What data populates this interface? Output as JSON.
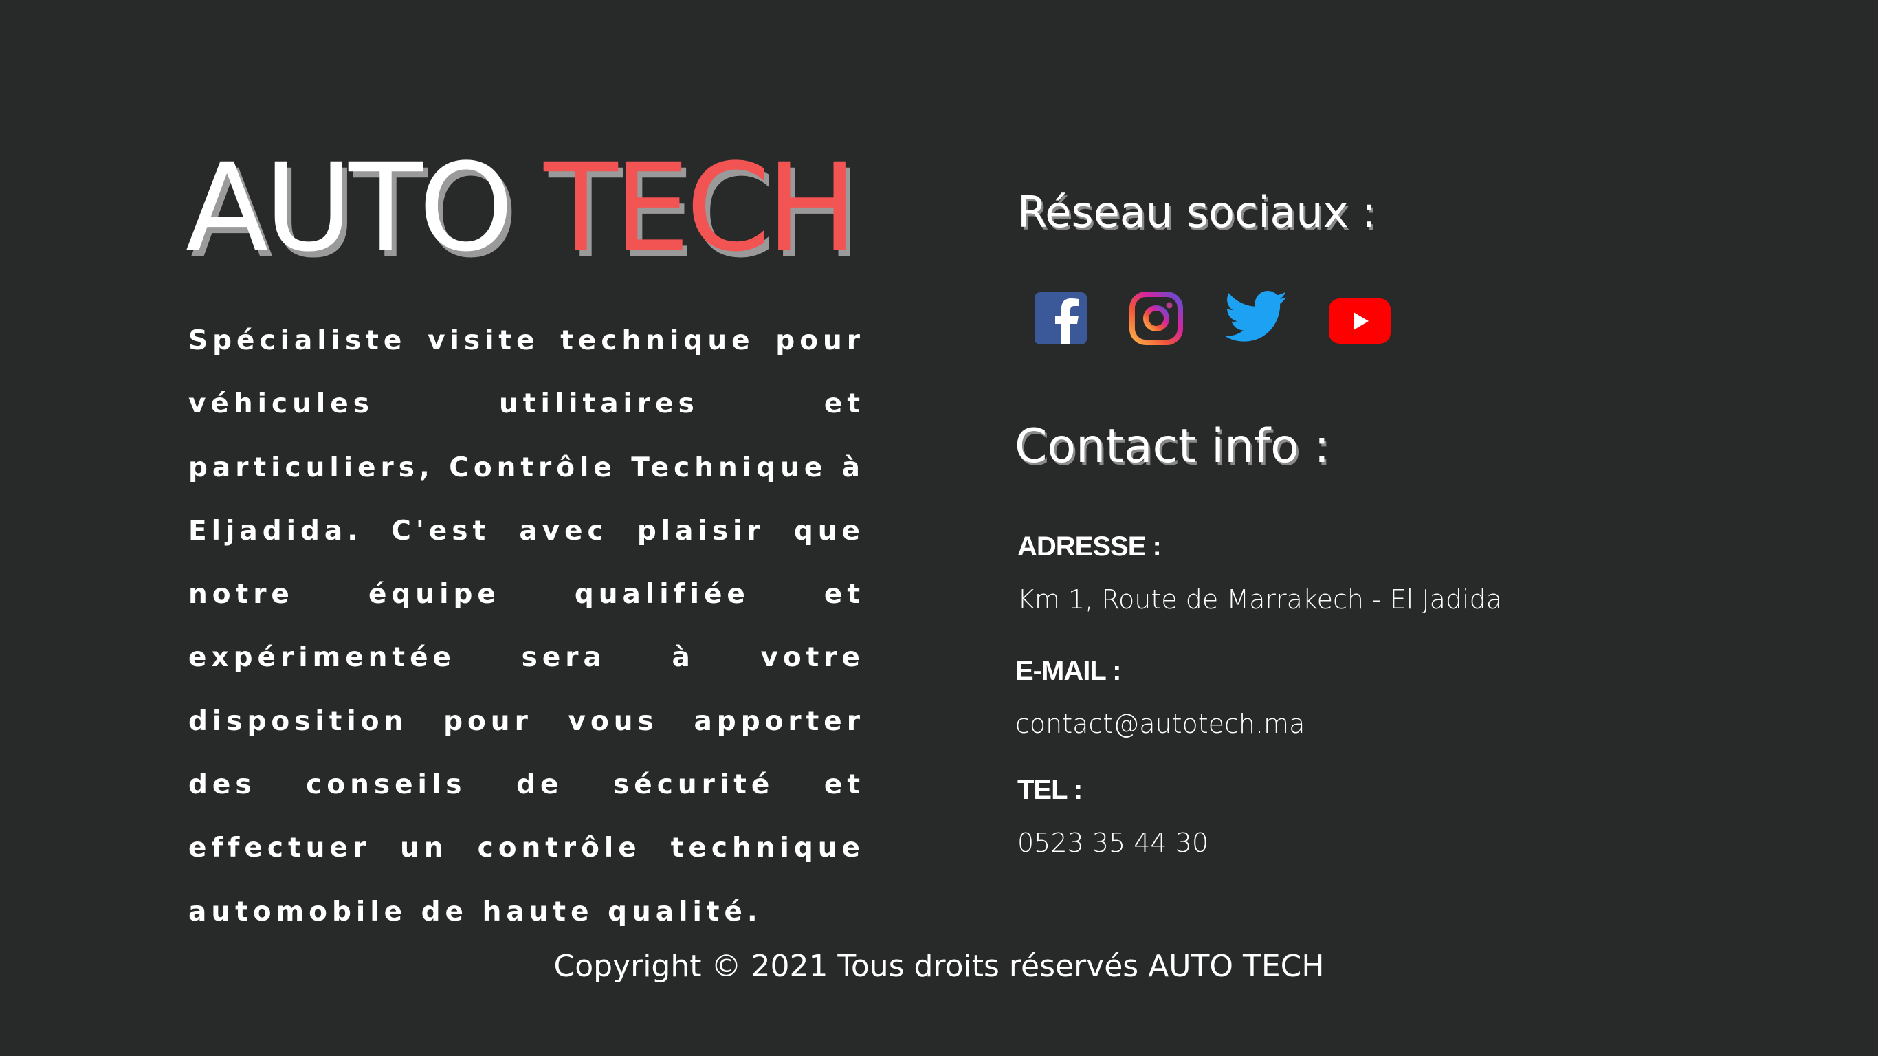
{
  "brand": {
    "part1": "AUTO ",
    "part2": "TECH",
    "accent_color": "#f25453",
    "text_color": "#ffffff",
    "background_color": "#282929"
  },
  "description": "Spécialiste visite technique pour véhicules utilitaires et particuliers, Contrôle Technique à Eljadida. C'est avec plaisir que notre équipe qualifiée et expérimentée sera à votre disposition pour vous apporter des conseils de sécurité et effectuer un contrôle technique automobile de haute qualité.",
  "social": {
    "title": "Réseau sociaux :",
    "icons": [
      {
        "name": "facebook-icon",
        "color": "#3b5998"
      },
      {
        "name": "instagram-icon",
        "color": "#d6249f"
      },
      {
        "name": "twitter-icon",
        "color": "#1da1f2"
      },
      {
        "name": "youtube-icon",
        "color": "#ff0000"
      }
    ]
  },
  "contact": {
    "title": "Contact info :",
    "address_label": "ADRESSE :",
    "address_value": "Km 1, Route de Marrakech - El Jadida",
    "email_label": "E-MAIL :",
    "email_value": "contact@autotech.ma",
    "tel_label": "TEL :",
    "tel_value": "0523 35 44 30"
  },
  "footer": {
    "copyright": "Copyright © 2021 Tous droits réservés AUTO TECH"
  }
}
